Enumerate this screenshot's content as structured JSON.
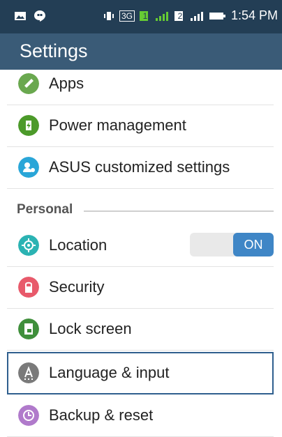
{
  "status_bar": {
    "time": "1:54 PM",
    "sim1": "1",
    "sim2": "2",
    "network": "3G"
  },
  "app_bar": {
    "title": "Settings"
  },
  "items_top": [
    {
      "label": "Apps",
      "icon": "apps-icon",
      "color": "#6aa84f"
    },
    {
      "label": "Power management",
      "icon": "power-management-icon",
      "color": "#4c9a2a"
    },
    {
      "label": "ASUS customized settings",
      "icon": "asus-customized-settings-icon",
      "color": "#2aa6d8"
    }
  ],
  "section": {
    "personal": "Personal"
  },
  "items_personal": [
    {
      "label": "Location",
      "icon": "location-icon",
      "color": "#2bb3b3",
      "toggle": "ON"
    },
    {
      "label": "Security",
      "icon": "security-icon",
      "color": "#e85a6b"
    },
    {
      "label": "Lock screen",
      "icon": "lock-screen-icon",
      "color": "#3f8f3b"
    },
    {
      "label": "Language & input",
      "icon": "language-input-icon",
      "color": "#7a7a7a"
    },
    {
      "label": "Backup & reset",
      "icon": "backup-reset-icon",
      "color": "#b07acb"
    }
  ]
}
